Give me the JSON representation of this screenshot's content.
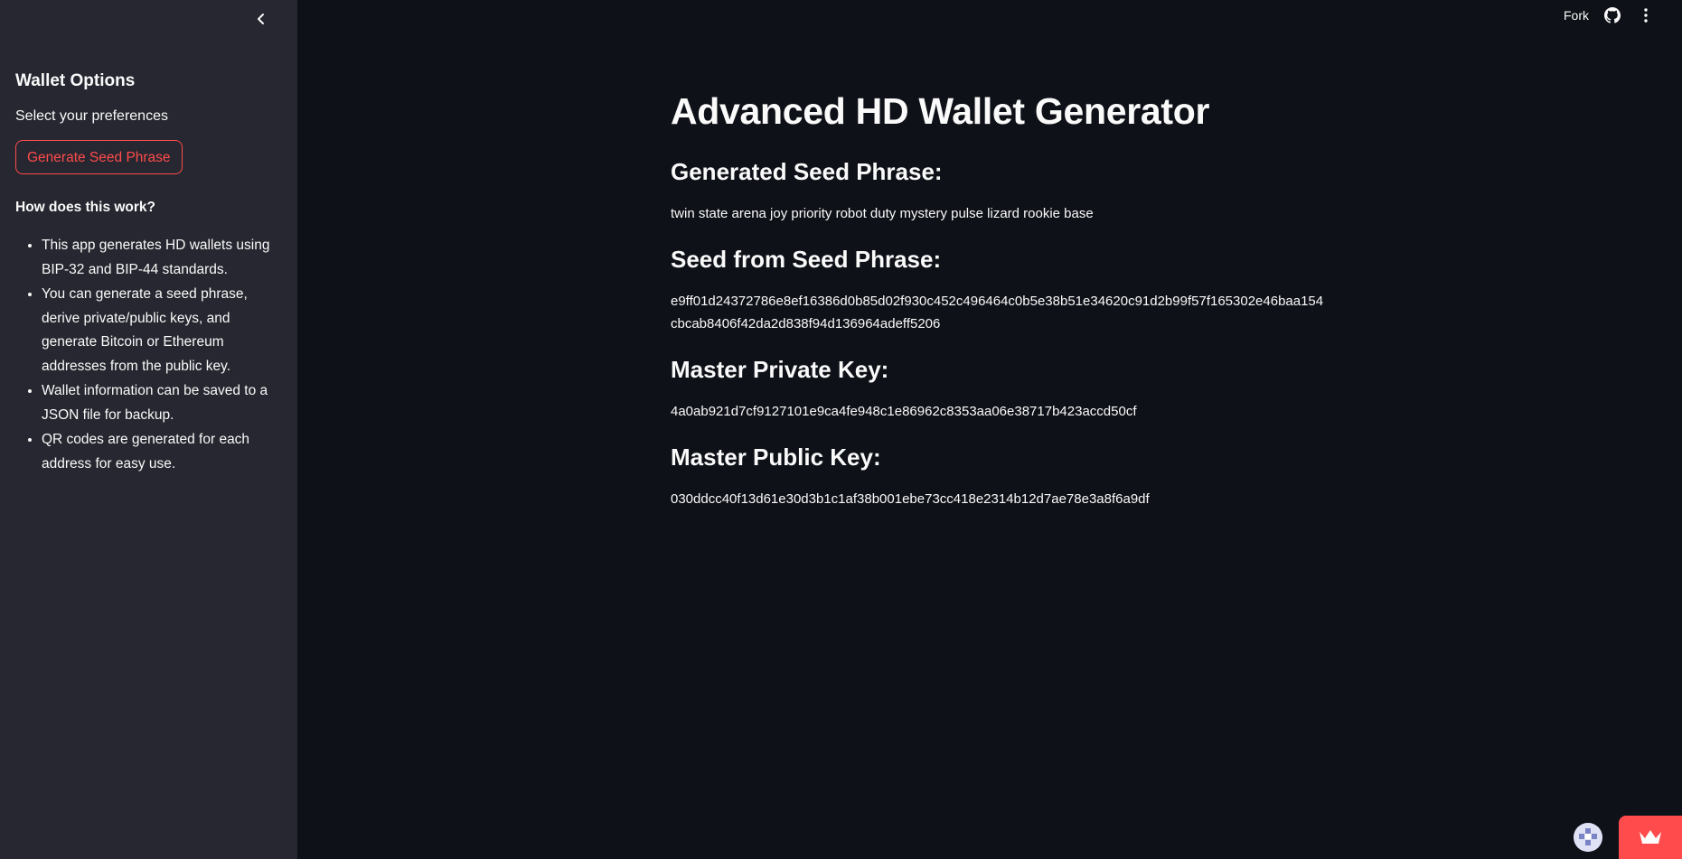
{
  "sidebar": {
    "title": "Wallet Options",
    "subtitle": "Select your preferences",
    "generate_button": "Generate Seed Phrase",
    "how_heading": "How does this work?",
    "items": [
      "This app generates HD wallets using BIP-32 and BIP-44 standards.",
      "You can generate a seed phrase, derive private/public keys, and generate Bitcoin or Ethereum addresses from the public key.",
      "Wallet information can be saved to a JSON file for backup.",
      "QR codes are generated for each address for easy use."
    ]
  },
  "header": {
    "fork_label": "Fork"
  },
  "main": {
    "title": "Advanced HD Wallet Generator",
    "seed_phrase_heading": "Generated Seed Phrase:",
    "seed_phrase": "twin state arena joy priority robot duty mystery pulse lizard rookie base",
    "seed_heading": "Seed from Seed Phrase:",
    "seed_line1": "e9ff01d24372786e8ef16386d0b85d02f930c452c496464c0b5e38b51e34620c91d2b99f57f165302e46baa154",
    "seed_line2": "cbcab8406f42da2d838f94d136964adeff5206",
    "private_key_heading": "Master Private Key:",
    "private_key": "4a0ab921d7cf9127101e9ca4fe948c1e86962c8353aa06e38717b423accd50cf",
    "public_key_heading": "Master Public Key:",
    "public_key": "030ddcc40f13d61e30d3b1c1af38b001ebe73cc418e2314b12d7ae78e3a8f6a9df"
  },
  "colors": {
    "background": "#0e1117",
    "sidebar": "#262730",
    "accent": "#ff4b4b",
    "text": "#fafafa"
  },
  "icons": {
    "collapse": "chevron-left-icon",
    "github": "github-icon",
    "menu": "kebab-menu-icon",
    "badge": "streamlit-avatar-icon",
    "crown": "crown-icon"
  }
}
